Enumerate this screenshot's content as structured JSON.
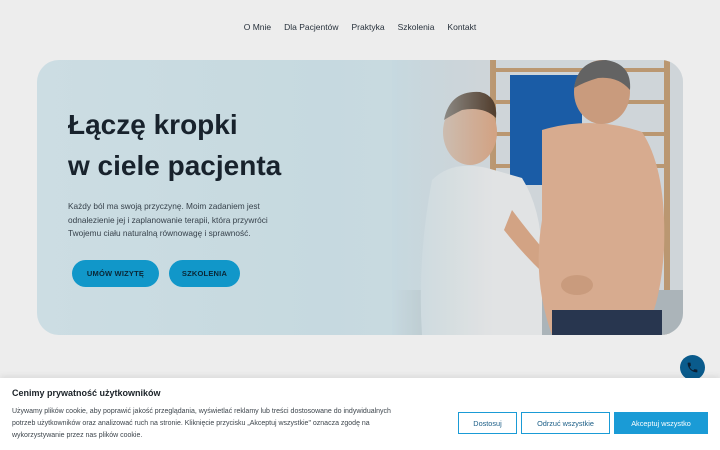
{
  "nav": {
    "items": [
      {
        "label": "O Mnie"
      },
      {
        "label": "Dla Pacjentów"
      },
      {
        "label": "Praktyka"
      },
      {
        "label": "Szkolenia"
      },
      {
        "label": "Kontakt"
      }
    ]
  },
  "hero": {
    "title_line1": "Łączę kropki",
    "title_line2": "w ciele pacjenta",
    "text_line1": "Każdy ból ma swoją przyczynę. Moim zadaniem jest",
    "text_line2": "odnalezienie jej i zaplanowanie terapii, która przywróci",
    "text_line3": "Twojemu ciału naturalną równowagę i sprawność.",
    "button_visit": "UMÓW WIZYTĘ",
    "button_training": "SZKOLENIA"
  },
  "cookie": {
    "title": "Cenimy prywatność użytkowników",
    "text_line1": "Używamy plików cookie, aby poprawić jakość przeglądania, wyświetlać reklamy lub treści dostosowane do indywidualnych",
    "text_line2": "potrzeb użytkowników oraz analizować ruch na stronie. Kliknięcie przycisku „Akceptuj wszystkie\" oznacza zgodę na",
    "text_line3": "wykorzystywanie przez nas plików cookie.",
    "button_customize": "Dostosuj",
    "button_reject": "Odrzuć wszystkie",
    "button_accept": "Akceptuj wszystko"
  },
  "colors": {
    "accent": "#13a3d9",
    "cookie_accent": "#1a9bd6",
    "phone_fab": "#0a5b8c"
  }
}
